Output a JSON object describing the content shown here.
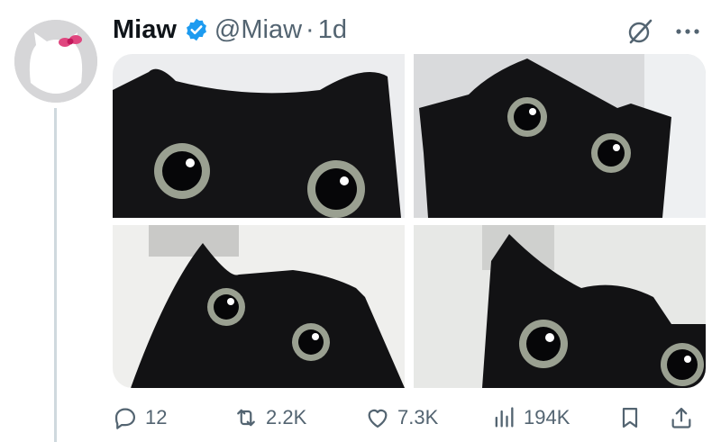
{
  "post": {
    "author_name": "Miaw",
    "handle": "@Miaw",
    "separator": "·",
    "time": "1d",
    "verified": true
  },
  "media": {
    "count": 4,
    "descriptions": [
      "black cat close-up wide eyes",
      "black cat looking up",
      "black cat looking up near wall",
      "black cat peeking close"
    ]
  },
  "actions": {
    "replies": "12",
    "reposts": "2.2K",
    "likes": "7.3K",
    "views": "194K"
  },
  "colors": {
    "verified_blue": "#1d9bf0",
    "muted_text": "#536471",
    "thread_line": "#cfd9de"
  },
  "icons": [
    "verified-badge-icon",
    "grok-icon",
    "more-icon",
    "reply-icon",
    "retweet-icon",
    "like-icon",
    "views-icon",
    "bookmark-icon",
    "share-icon"
  ]
}
